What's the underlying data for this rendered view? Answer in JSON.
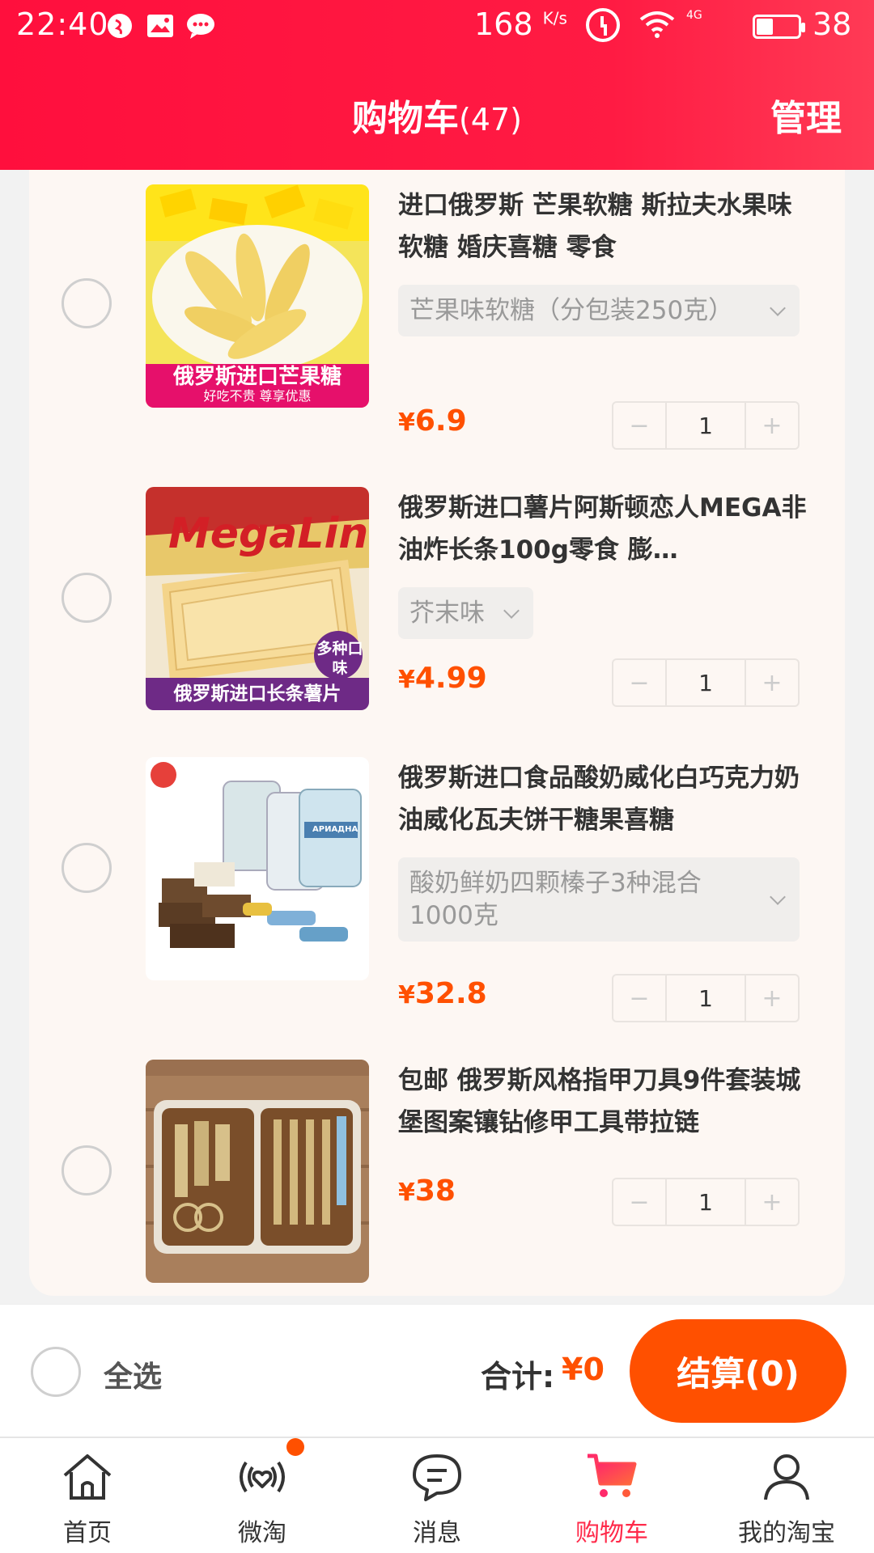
{
  "status_bar": {
    "time": "22:40",
    "net_speed": "168",
    "net_speed_unit": "K/s",
    "network": "4G",
    "battery": "38"
  },
  "header": {
    "title": "购物车",
    "count": "(47)",
    "manage": "管理"
  },
  "items": [
    {
      "name": "进口俄罗斯 芒果软糖 斯拉夫水果味软糖 婚庆喜糖 零食",
      "sku": "芒果味软糖（分包装250克）",
      "currency": "¥",
      "price": "6.9",
      "qty": "1",
      "image_caption": "俄罗斯进口芒果糖",
      "image_subcaption": "好吃不贵 尊享优惠"
    },
    {
      "name": "俄罗斯进口薯片阿斯顿恋人MEGA非油炸长条100g零食 膨…",
      "sku": "芥末味",
      "currency": "¥",
      "price": "4.99",
      "qty": "1",
      "image_caption": "俄罗斯进口长条薯片",
      "image_badge": "多种口味",
      "image_brand": "MegaLine"
    },
    {
      "name": "俄罗斯进口食品酸奶威化白巧克力奶油威化瓦夫饼干糖果喜糖",
      "sku": "酸奶鲜奶四颗榛子3种混合1000克",
      "currency": "¥",
      "price": "32.8",
      "qty": "1",
      "image_label": "АРИАДНА"
    },
    {
      "name": "包邮 俄罗斯风格指甲刀具9件套装城堡图案镶钻修甲工具带拉链",
      "currency": "¥",
      "price": "38",
      "qty": "1"
    }
  ],
  "stepper": {
    "minus": "−",
    "plus": "+"
  },
  "checkout": {
    "select_all": "全选",
    "total_label": "合计:",
    "total_value": "¥0",
    "pay_label": "结算(0)"
  },
  "tabs": [
    {
      "label": "首页",
      "icon": "home-icon"
    },
    {
      "label": "微淘",
      "icon": "weitao-icon",
      "badge": true
    },
    {
      "label": "消息",
      "icon": "message-icon"
    },
    {
      "label": "购物车",
      "icon": "cart-icon",
      "active": true
    },
    {
      "label": "我的淘宝",
      "icon": "profile-icon"
    }
  ],
  "colors": {
    "header_red": "#ff0f3d",
    "price_orange": "#ff5000",
    "active_tab": "#ff2a4a"
  }
}
